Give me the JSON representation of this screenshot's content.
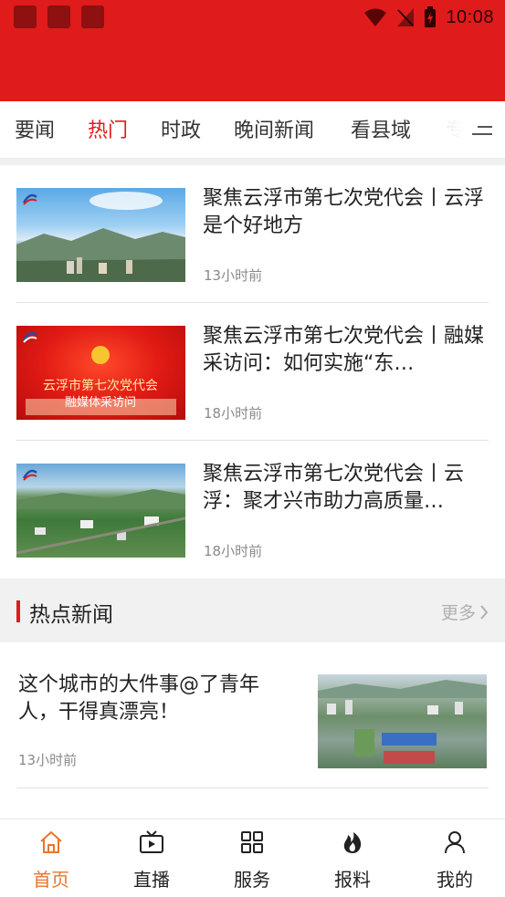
{
  "status_bar": {
    "time": "10:08"
  },
  "tabs": [
    {
      "label": "要闻"
    },
    {
      "label": "热门"
    },
    {
      "label": "时政"
    },
    {
      "label": "晚间新闻"
    },
    {
      "label": "看县域"
    },
    {
      "label": "专"
    }
  ],
  "news": [
    {
      "title": "聚焦云浮市第七次党代会丨云浮是个好地方",
      "time": "13小时前"
    },
    {
      "title": "聚焦云浮市第七次党代会丨融媒采访问：如何实施“东…",
      "time": "18小时前",
      "thumb_text_1": "云浮市第七次党代会",
      "thumb_text_2": "融媒体采访问"
    },
    {
      "title": "聚焦云浮市第七次党代会丨云浮：聚才兴市助力高质量…",
      "time": "18小时前"
    }
  ],
  "hot_news": {
    "title": "热点新闻",
    "more": "更多",
    "items": [
      {
        "title": "这个城市的大件事@了青年人，干得真漂亮！",
        "time": "13小时前"
      }
    ]
  },
  "bottom_nav": [
    {
      "label": "首页",
      "icon": "home-icon",
      "active": true
    },
    {
      "label": "直播",
      "icon": "live-tv-icon"
    },
    {
      "label": "服务",
      "icon": "grid-icon"
    },
    {
      "label": "报料",
      "icon": "fire-icon"
    },
    {
      "label": "我的",
      "icon": "user-icon"
    }
  ],
  "colors": {
    "brand": "#e01b1b",
    "active_nav": "#e8742e"
  }
}
